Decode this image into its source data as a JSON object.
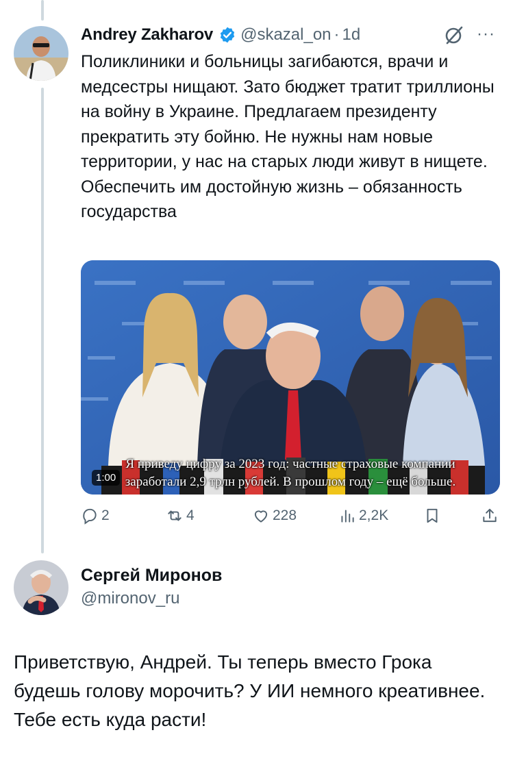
{
  "tweet": {
    "author_name": "Andrey Zakharov",
    "author_handle": "@skazal_on",
    "separator": "·",
    "time": "1d",
    "text": "Поликлиники и больницы загибаются, врачи и медсестры нищают. Зато бюджет тратит триллионы на войну в Украине. Предлагаем президенту прекратить эту бойню. Не нужны нам новые территории, у нас на старых люди живут в нищете. Обеспечить им достойную жизнь – обязанность государства",
    "more_label": "···",
    "video": {
      "duration": "1:00",
      "subtitle_line1": "Я приведу цифру за 2023 год: частные страховые компании",
      "subtitle_line2": "заработали 2,9 трлн рублей. В прошлом году – ещё больше."
    },
    "metrics": {
      "replies": "2",
      "reposts": "4",
      "likes": "228",
      "views": "2,2K"
    }
  },
  "reply": {
    "author_name": "Сергей Миронов",
    "author_handle": "@mironov_ru",
    "text": "Приветствую, Андрей. Ты теперь вместо Грока будешь голову морочить? У ИИ немного креативнее. Тебе есть куда расти!"
  },
  "colors": {
    "verified": "#1d9bf0",
    "secondary_text": "#536471",
    "thread_line": "#cfd9de"
  }
}
